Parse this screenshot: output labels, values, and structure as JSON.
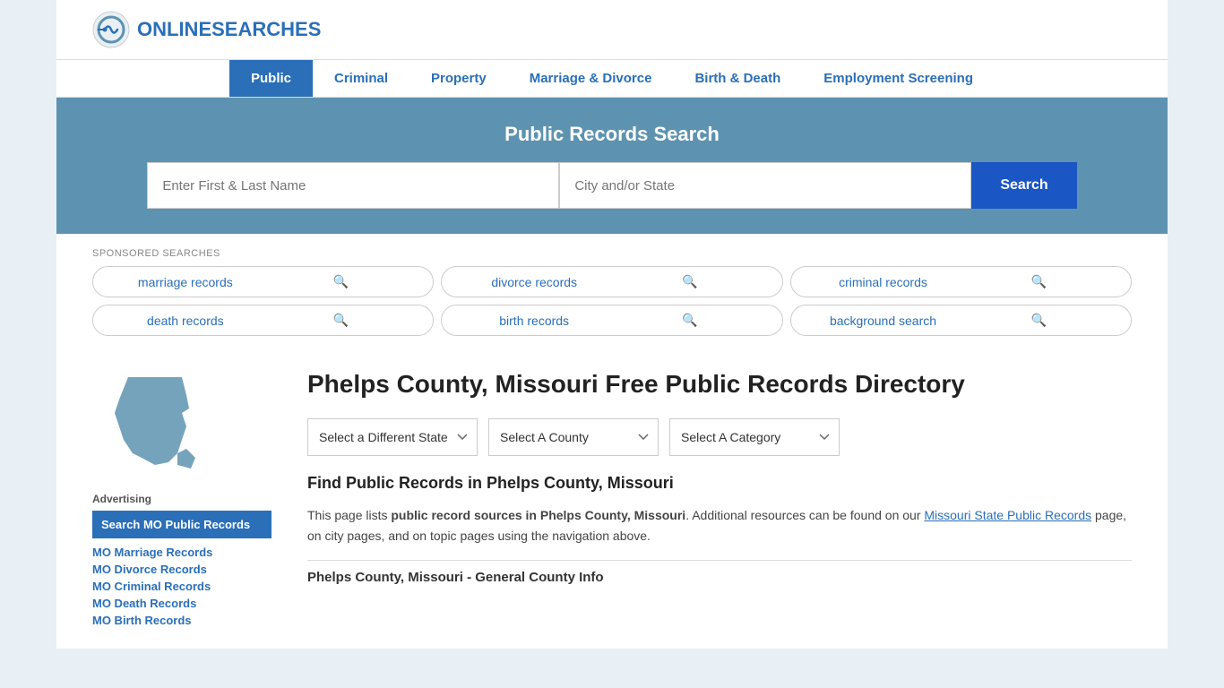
{
  "header": {
    "logo_text_plain": "ONLINE",
    "logo_text_colored": "SEARCHES"
  },
  "nav": {
    "items": [
      {
        "label": "Public",
        "active": true
      },
      {
        "label": "Criminal",
        "active": false
      },
      {
        "label": "Property",
        "active": false
      },
      {
        "label": "Marriage & Divorce",
        "active": false
      },
      {
        "label": "Birth & Death",
        "active": false
      },
      {
        "label": "Employment Screening",
        "active": false
      }
    ]
  },
  "search_banner": {
    "title": "Public Records Search",
    "name_placeholder": "Enter First & Last Name",
    "city_placeholder": "City and/or State",
    "search_button": "Search"
  },
  "sponsored": {
    "label": "SPONSORED SEARCHES",
    "tags": [
      "marriage records",
      "divorce records",
      "criminal records",
      "death records",
      "birth records",
      "background search"
    ]
  },
  "page_title": "Phelps County, Missouri Free Public Records Directory",
  "dropdowns": {
    "state": "Select a Different State",
    "county": "Select A County",
    "category": "Select A Category"
  },
  "find_heading": "Find Public Records in Phelps County, Missouri",
  "description": {
    "part1": "This page lists ",
    "bold1": "public record sources in Phelps County, Missouri",
    "part2": ". Additional resources can be found on our ",
    "link_text": "Missouri State Public Records",
    "part3": " page, on city pages, and on topic pages using the navigation above."
  },
  "county_info_label": "Phelps County, Missouri - General County Info",
  "sidebar": {
    "advertising_label": "Advertising",
    "ad_box_text": "Search MO Public Records",
    "links": [
      "MO Marriage Records",
      "MO Divorce Records",
      "MO Criminal Records",
      "MO Death Records",
      "MO Birth Records"
    ]
  }
}
